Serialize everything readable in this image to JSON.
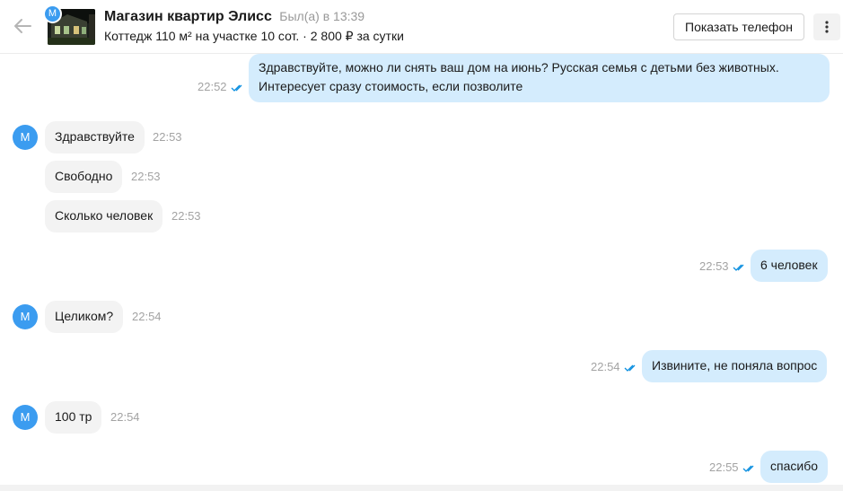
{
  "header": {
    "avatar_letter": "M",
    "title": "Магазин квартир Элисс",
    "last_seen": "Был(а) в 13:39",
    "subtitle": "Коттедж 110 м² на участке 10 сот. · 2 800 ₽ за сутки",
    "phone_button": "Показать телефон"
  },
  "colors": {
    "accent": "#3b9cf0",
    "outgoing_bubble": "#d4ecfd",
    "incoming_bubble": "#f3f3f3",
    "read_ticks": "#0b8fe0"
  },
  "messages": [
    {
      "direction": "out",
      "lines": [
        "Здравствуйте, можно ли снять ваш дом на июнь? Русская семья с детьми без животных.",
        "Интересует сразу стоимость, если позволите"
      ],
      "time": "22:52"
    },
    {
      "direction": "in",
      "avatar": "M",
      "text": "Здравствуйте",
      "time": "22:53"
    },
    {
      "direction": "in",
      "text": "Свободно",
      "time": "22:53"
    },
    {
      "direction": "in",
      "text": "Сколько человек",
      "time": "22:53"
    },
    {
      "direction": "out",
      "text": "6 человек",
      "time": "22:53"
    },
    {
      "direction": "in",
      "avatar": "M",
      "text": "Целиком?",
      "time": "22:54"
    },
    {
      "direction": "out",
      "text": "Извините, не поняла вопрос",
      "time": "22:54"
    },
    {
      "direction": "in",
      "avatar": "M",
      "text": "100 тр",
      "time": "22:54"
    },
    {
      "direction": "out",
      "text": "спасибо",
      "time": "22:55"
    }
  ]
}
